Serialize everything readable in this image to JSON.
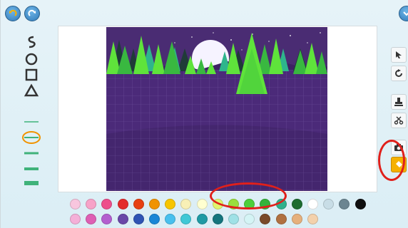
{
  "colors": {
    "sky": "#4a2c73",
    "ground": "#4b2a79",
    "ground_dark": "#3d2163",
    "tree_light": "#5fe33b",
    "tree_mid": "#39b840",
    "tree_teal": "#2eb58c",
    "tree_dark": "#1f3b38",
    "moon": "#f6f3ff",
    "annotation": "#e0201b",
    "fill_button": "#f5b100"
  },
  "top_buttons": [
    {
      "name": "undo-button",
      "icon": "undo-arrow-icon",
      "color": "#f5b100"
    },
    {
      "name": "redo-button",
      "icon": "redo-arrow-icon",
      "color": "#ffffff"
    },
    {
      "name": "close-button",
      "icon": "close-icon",
      "color": "#ffffff"
    }
  ],
  "left_tools": [
    "curve-tool-icon",
    "circle-tool-icon",
    "rectangle-tool-icon",
    "triangle-tool-icon",
    "line-thin-icon",
    "ellipse-selected-icon",
    "line-medium-icon",
    "line-thick-icon",
    "line-extra-thick-icon"
  ],
  "right_tools": [
    "select-arrow-icon",
    "rotate-icon",
    "stamp-icon",
    "scissors-icon",
    "camera-icon",
    "paint-bucket-icon"
  ],
  "palette_row1": [
    "#f8c6de",
    "#f7a3c8",
    "#ee4f8b",
    "#e32b2b",
    "#e74012",
    "#f09300",
    "#f7c500",
    "#f8f0b6",
    "#ffffd0",
    "#e1f46e",
    "#9ade3d",
    "#4ccf3b",
    "#35b33a",
    "#2fb08c",
    "#1d6c2f",
    "#ffffff",
    "#c8dde6",
    "#6c8591",
    "#0f0f0f"
  ],
  "palette_row2": [
    "#f4b0d8",
    "#de5fb4",
    "#b45ecf",
    "#6a47a8",
    "#2f54b4",
    "#1a86d6",
    "#48c0ee",
    "#40c8d6",
    "#1e9aa4",
    "#14757d",
    "#9fe1e6",
    "#d4f4f5",
    "#7a4a2a",
    "#b07040",
    "#e6b07c",
    "#f3d1ac"
  ]
}
